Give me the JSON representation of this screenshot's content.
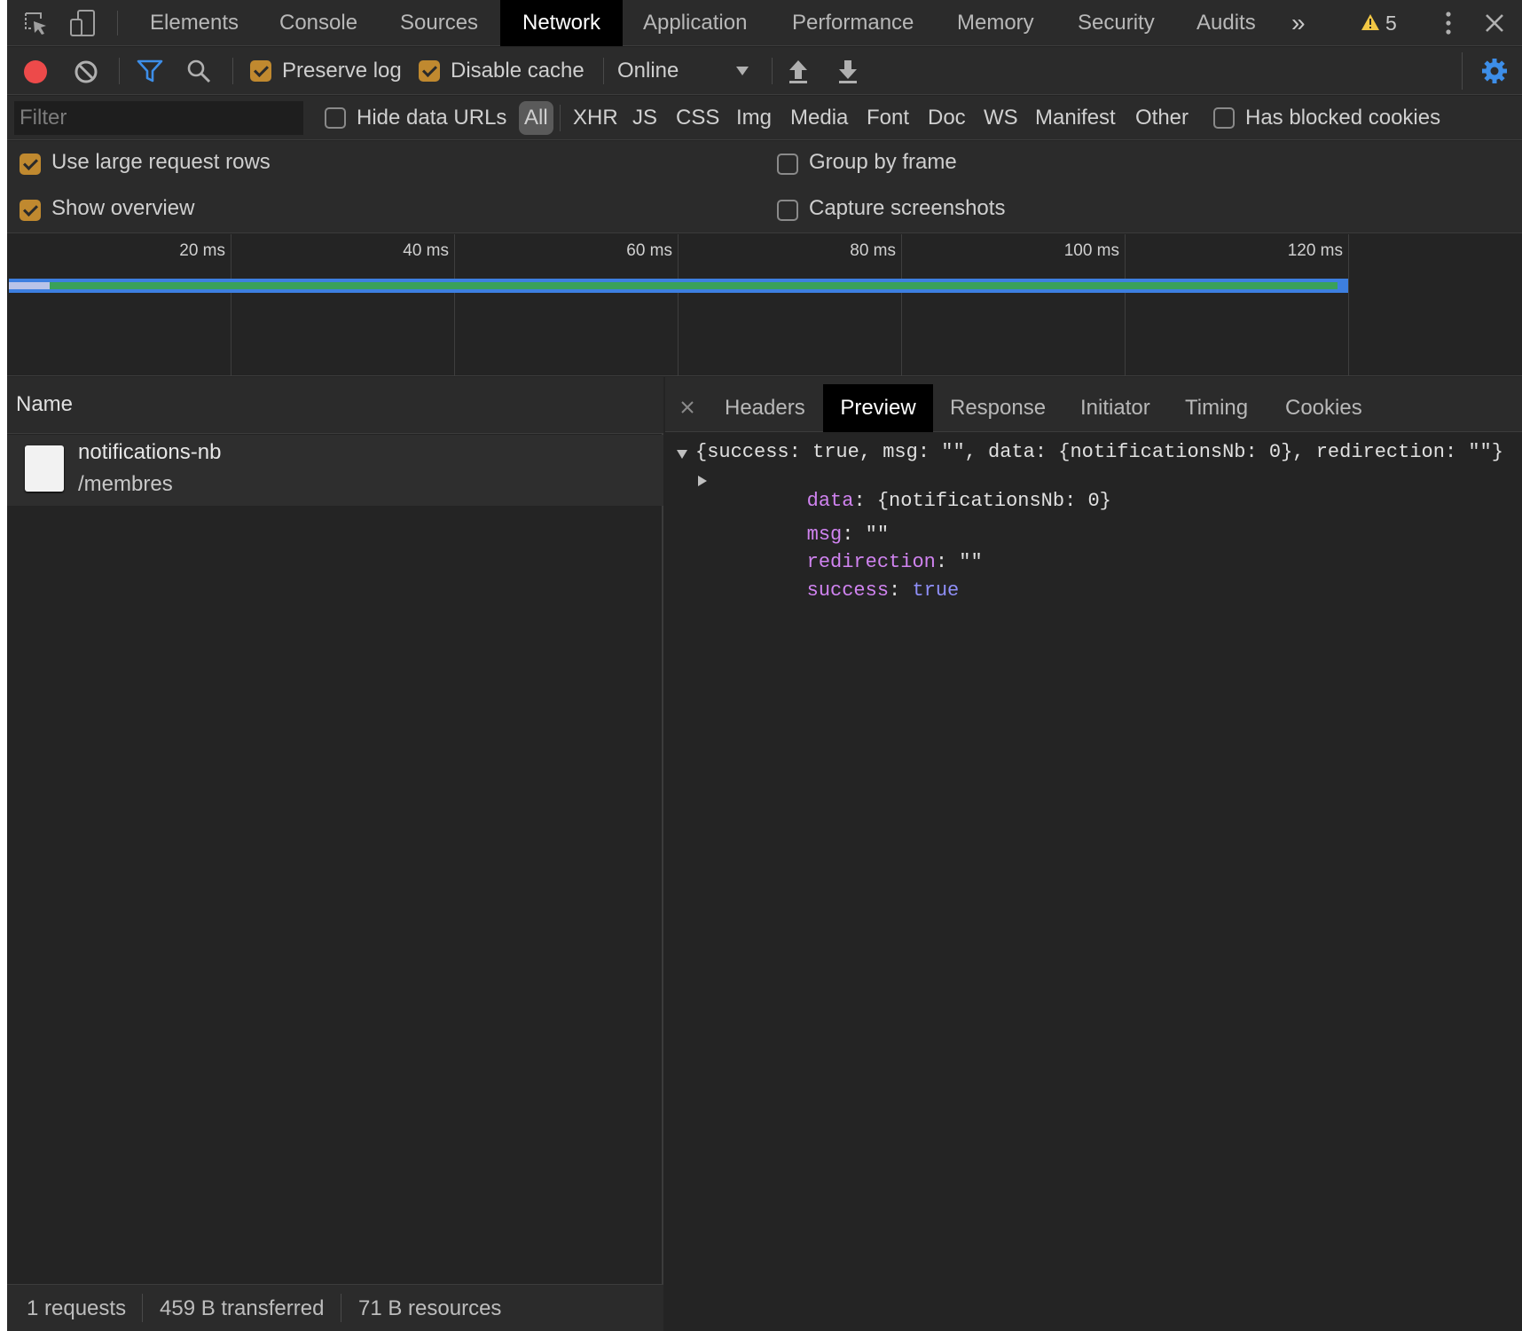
{
  "main_tabs": [
    "Elements",
    "Console",
    "Sources",
    "Network",
    "Application",
    "Performance",
    "Memory",
    "Security",
    "Audits"
  ],
  "more_tabs_glyph": "»",
  "warnings": {
    "count": "5"
  },
  "toolbar": {
    "preserve_log": {
      "label": "Preserve log",
      "checked": true
    },
    "disable_cache": {
      "label": "Disable cache",
      "checked": true
    },
    "throttling": "Online"
  },
  "filter": {
    "placeholder": "Filter",
    "hide_data_urls": {
      "label": "Hide data URLs",
      "checked": false
    },
    "types": [
      "All",
      "XHR",
      "JS",
      "CSS",
      "Img",
      "Media",
      "Font",
      "Doc",
      "WS",
      "Manifest",
      "Other"
    ],
    "selected_type": "All",
    "has_blocked_cookies": {
      "label": "Has blocked cookies",
      "checked": false
    }
  },
  "settings": {
    "use_large_rows": {
      "label": "Use large request rows",
      "checked": true
    },
    "show_overview": {
      "label": "Show overview",
      "checked": true
    },
    "group_by_frame": {
      "label": "Group by frame",
      "checked": false
    },
    "capture_screenshots": {
      "label": "Capture screenshots",
      "checked": false
    }
  },
  "overview": {
    "ticks": [
      "20 ms",
      "40 ms",
      "60 ms",
      "80 ms",
      "100 ms",
      "120 ms"
    ]
  },
  "request_list": {
    "column_name": "Name",
    "requests": [
      {
        "name": "notifications-nb",
        "path": "/membres"
      }
    ]
  },
  "status": {
    "requests": "1 requests",
    "transferred": "459 B transferred",
    "resources": "71 B resources"
  },
  "details": {
    "tabs": [
      "Headers",
      "Preview",
      "Response",
      "Initiator",
      "Timing",
      "Cookies"
    ],
    "active_tab": "Preview",
    "preview": {
      "summary": "{success: true, msg: \"\", data: {notificationsNb: 0}, redirection: \"\"}",
      "props": [
        {
          "key": "data",
          "value": "{notificationsNb: 0}",
          "expandable": true
        },
        {
          "key": "msg",
          "value": "\"\"",
          "expandable": false
        },
        {
          "key": "redirection",
          "value": "\"\"",
          "expandable": false
        },
        {
          "key": "success",
          "value": "true",
          "expandable": false
        }
      ]
    }
  },
  "colors": {
    "record": "#ed4a4a",
    "accent": "#3d7fe0",
    "checkbox": "#c0892f",
    "warning": "#f2c744"
  }
}
